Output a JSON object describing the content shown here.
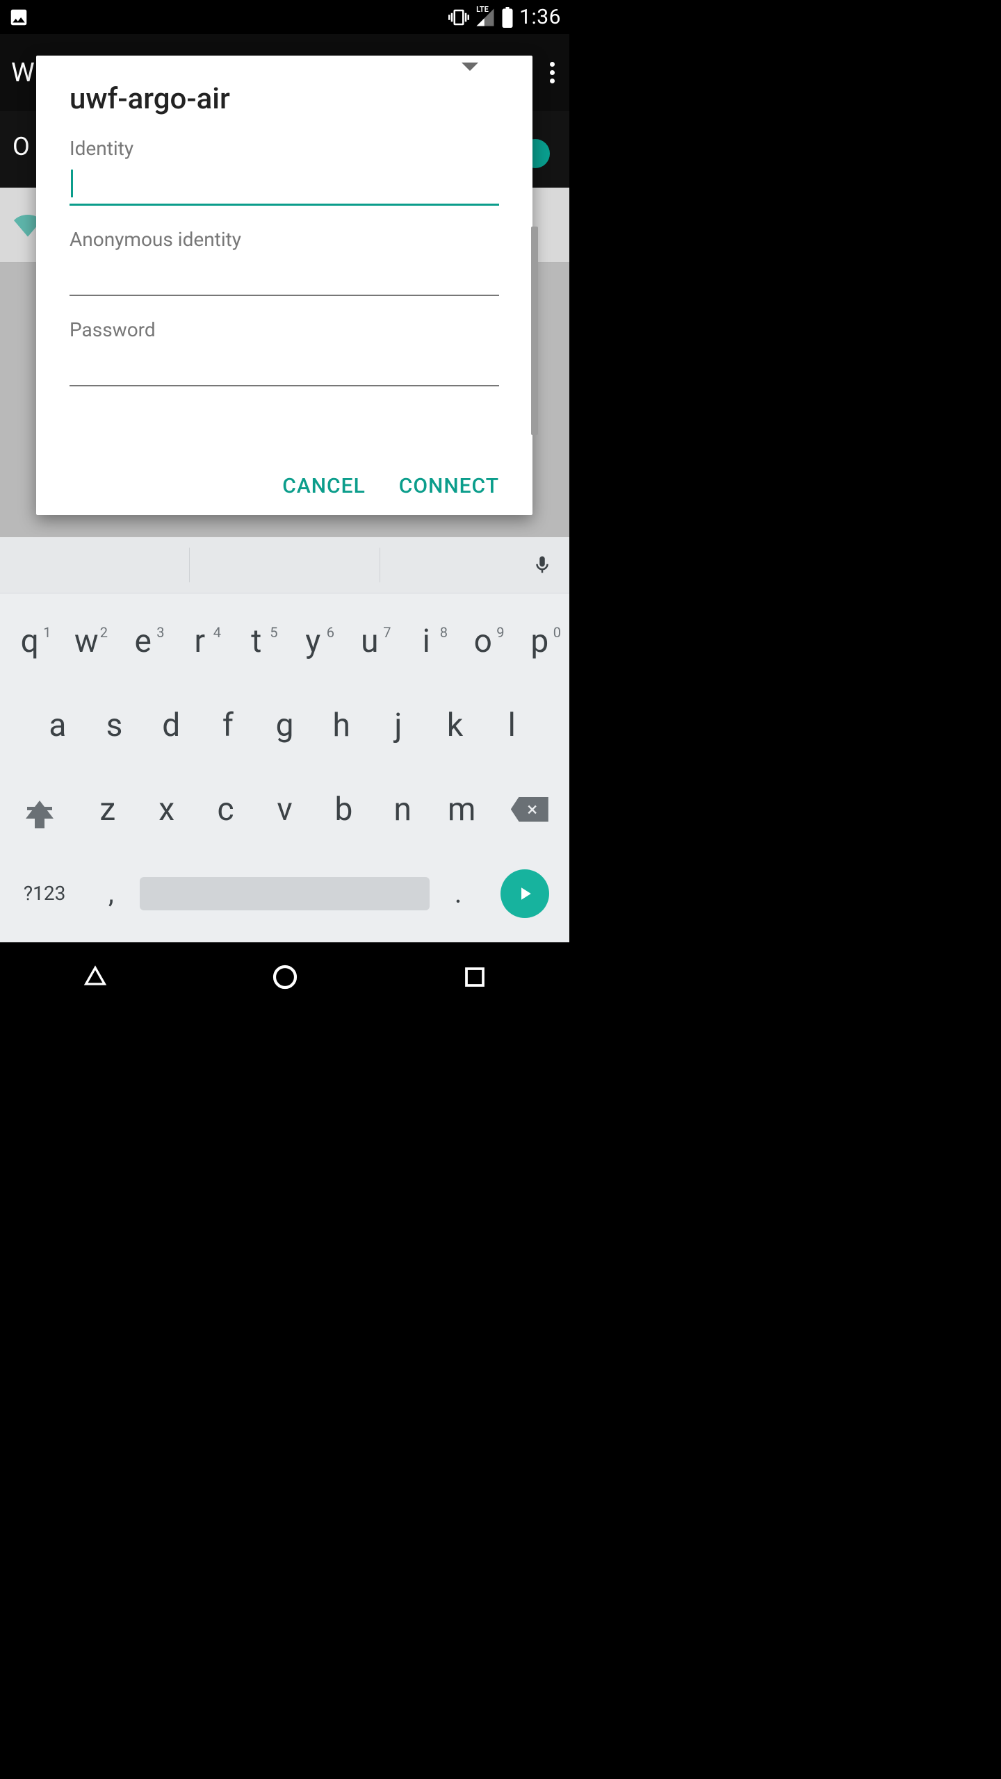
{
  "status": {
    "network_label": "LTE",
    "time": "1:36"
  },
  "app": {
    "title_letter_visible": "W",
    "background_toggle_letter": "O"
  },
  "dialog": {
    "title": "uwf-argo-air",
    "fields": {
      "identity_label": "Identity",
      "identity_value": "",
      "anonymous_label": "Anonymous identity",
      "anonymous_value": "",
      "password_label": "Password",
      "password_value": ""
    },
    "buttons": {
      "cancel": "CANCEL",
      "connect": "CONNECT"
    }
  },
  "keyboard": {
    "row1": [
      {
        "k": "q",
        "h": "1"
      },
      {
        "k": "w",
        "h": "2"
      },
      {
        "k": "e",
        "h": "3"
      },
      {
        "k": "r",
        "h": "4"
      },
      {
        "k": "t",
        "h": "5"
      },
      {
        "k": "y",
        "h": "6"
      },
      {
        "k": "u",
        "h": "7"
      },
      {
        "k": "i",
        "h": "8"
      },
      {
        "k": "o",
        "h": "9"
      },
      {
        "k": "p",
        "h": "0"
      }
    ],
    "row2": [
      "a",
      "s",
      "d",
      "f",
      "g",
      "h",
      "j",
      "k",
      "l"
    ],
    "row3": [
      "z",
      "x",
      "c",
      "v",
      "b",
      "n",
      "m"
    ],
    "symbols": "?123",
    "comma": ",",
    "period": "."
  }
}
